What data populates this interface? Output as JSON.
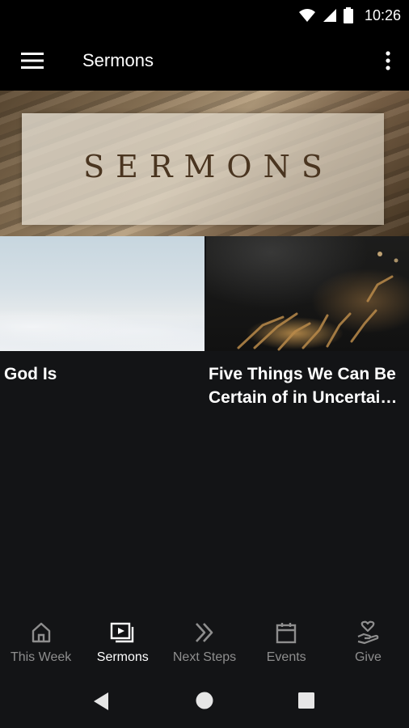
{
  "status_bar": {
    "time": "10:26"
  },
  "app_bar": {
    "title": "Sermons"
  },
  "hero": {
    "title": "SERMONS"
  },
  "sermons": [
    {
      "title": "God Is"
    },
    {
      "title": "Five Things We Can Be Certain of in Uncertain Times"
    }
  ],
  "bottom_nav": {
    "items": [
      {
        "label": "This Week",
        "icon": "home-icon"
      },
      {
        "label": "Sermons",
        "icon": "video-library-icon"
      },
      {
        "label": "Next Steps",
        "icon": "double-chevron-right-icon"
      },
      {
        "label": "Events",
        "icon": "calendar-icon"
      },
      {
        "label": "Give",
        "icon": "give-heart-icon"
      }
    ],
    "active": "Sermons"
  },
  "colors": {
    "background": "#131416",
    "bar": "#000000",
    "nav_inactive": "#8e8e8e",
    "nav_active": "#ffffff"
  }
}
